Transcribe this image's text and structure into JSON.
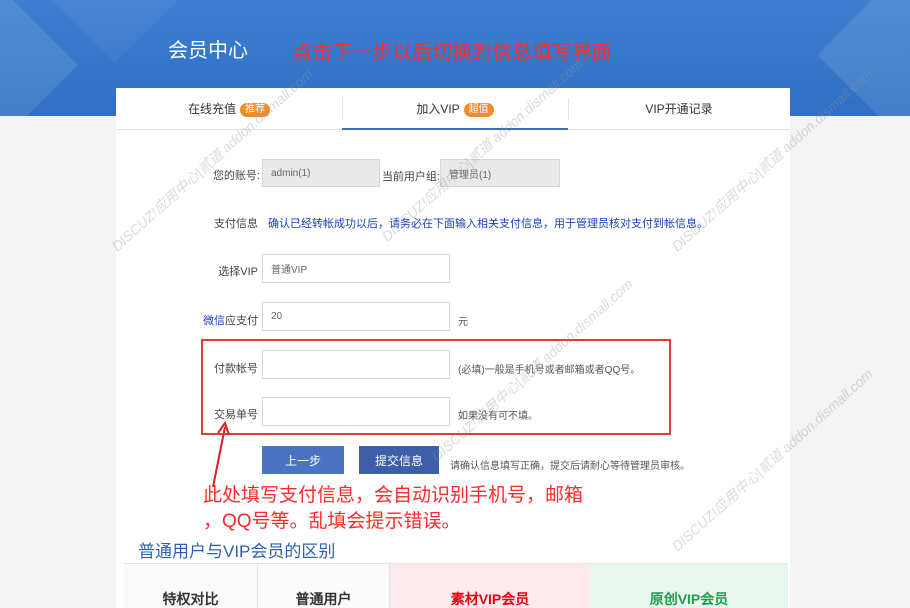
{
  "header": {
    "title": "会员中心",
    "annotation": "点击下一步以后切换到信息填写界面"
  },
  "tabs": [
    {
      "label": "在线充值",
      "badge": "推荐"
    },
    {
      "label": "加入VIP",
      "badge": "超值"
    },
    {
      "label": "VIP开通记录",
      "badge": ""
    }
  ],
  "form": {
    "account_label": "您的账号:",
    "account_value": "admin(1)",
    "group_label": "当前用户组:",
    "group_value": "管理员(1)",
    "payinfo_label": "支付信息",
    "payinfo_text": "确认已经转帐成功以后，请务必在下面输入相关支付信息，用于管理员核对支付到帐信息。",
    "vip_label": "选择VIP",
    "vip_value": "普通VIP",
    "wechat_word": "微信",
    "due_label": "应支付",
    "due_value": "20",
    "due_unit": "元",
    "payaccount_label": "付款帐号",
    "payaccount_hint": "(必填)一般是手机号或者邮箱或者QQ号。",
    "txn_label": "交易单号",
    "txn_hint": "如果没有可不填。",
    "prev_button": "上一步",
    "submit_button": "提交信息",
    "submit_hint": "请确认信息填写正确，提交后请耐心等待管理员审核。"
  },
  "annotation_bottom": {
    "line1": "此处填写支付信息，会自动识别手机号，邮箱",
    "line2": "，QQ号等。乱填会提示错误。"
  },
  "compare": {
    "title": "普通用户与VIP会员的区别",
    "headers": [
      "特权对比",
      "普通用户",
      "素材VIP会员",
      "原创VIP会员"
    ]
  },
  "watermark": "DISCUZ!应用中心|贰道 addon.dismall.com",
  "colors": {
    "banner": "#2f6fc4",
    "annotation": "#ff2a2a",
    "tab_badge": "#f58a2b",
    "button": "#4a73c2"
  }
}
